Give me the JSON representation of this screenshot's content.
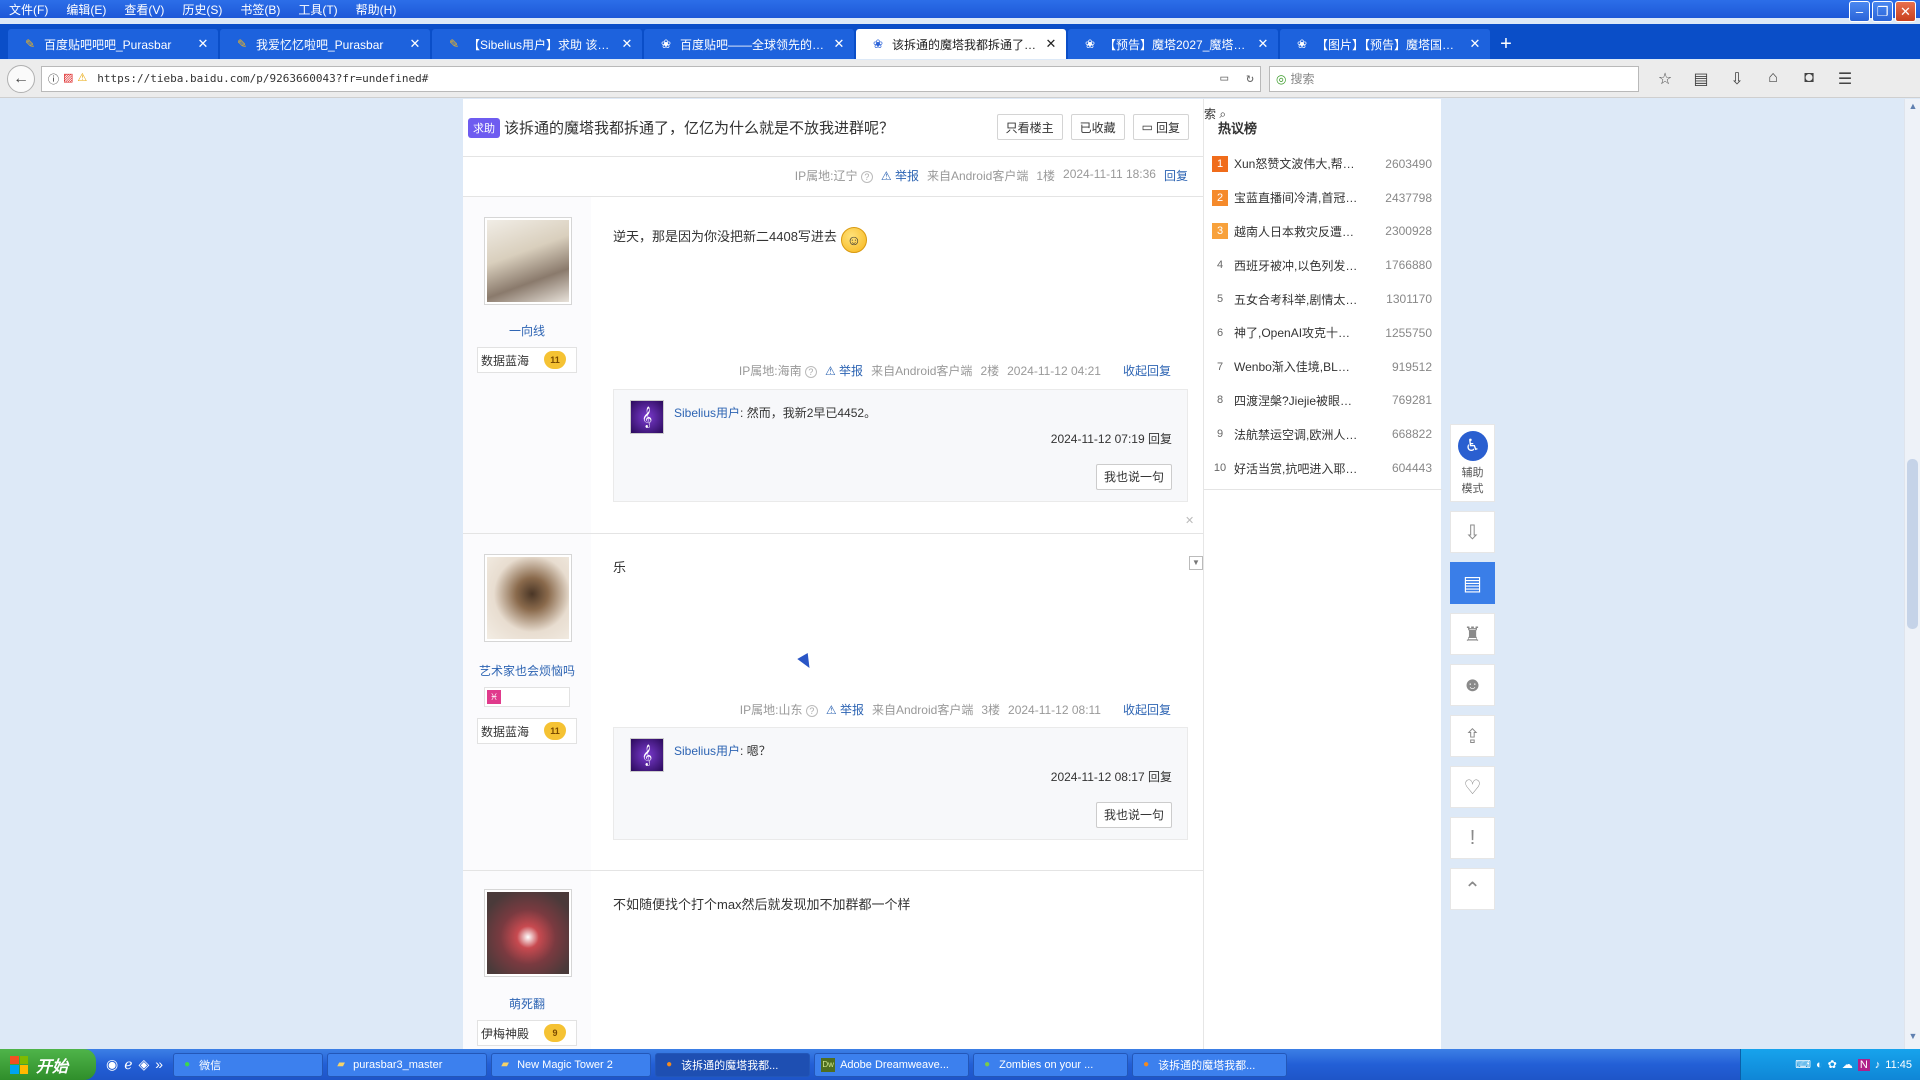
{
  "menubar": {
    "items": [
      "文件(F)",
      "编辑(E)",
      "查看(V)",
      "历史(S)",
      "书签(B)",
      "工具(T)",
      "帮助(H)"
    ]
  },
  "tabs": [
    {
      "title": "百度贴吧吧吧_Purasbar",
      "icon": "pencil-icon"
    },
    {
      "title": "我爱忆忆啦吧_Purasbar",
      "icon": "pencil-icon"
    },
    {
      "title": "【Sibelius用户】求助 该…",
      "icon": "pencil-icon"
    },
    {
      "title": "百度贴吧——全球领先的…",
      "icon": "paw-icon"
    },
    {
      "title": "该拆通的魔塔我都拆通了…",
      "icon": "paw-icon",
      "active": true
    },
    {
      "title": "【预告】魔塔2027_魔塔吧…",
      "icon": "paw-icon"
    },
    {
      "title": "【图片】【预告】魔塔国…",
      "icon": "paw-icon"
    }
  ],
  "nav": {
    "url": "https://tieba.baidu.com/p/9263660043?fr=undefined#",
    "search_placeholder": "搜索"
  },
  "thread": {
    "tag": "求助",
    "title": "该拆通的魔塔我都拆通了，亿亿为什么就是不放我进群呢？",
    "buttons": [
      "只看楼主",
      "已收藏",
      "回复"
    ]
  },
  "floor1_meta": {
    "ip": "IP属地:辽宁",
    "report": "举报",
    "client": "来自Android客户端",
    "floor": "1楼",
    "time": "2024-11-11 18:36",
    "reply": "回复"
  },
  "posts": [
    {
      "author": "一向线",
      "badge_text": "数据蓝海",
      "level": "11",
      "content": "逆天，那是因为你没把新二4408写进去",
      "ip": "IP属地:海南",
      "report": "举报",
      "client": "来自Android客户端",
      "floor": "2楼",
      "time": "2024-11-12 04:21",
      "collapse": "收起回复",
      "lzl": {
        "user": "Sibelius用户",
        "text": ": 然而，我新2早已4452。",
        "time": "2024-11-12 07:19",
        "reply": "回复",
        "btn": "我也说一句"
      }
    },
    {
      "author": "艺术家也会烦恼吗",
      "badge_text": "数据蓝海",
      "level": "11",
      "content": "乐",
      "ip": "IP属地:山东",
      "report": "举报",
      "client": "来自Android客户端",
      "floor": "3楼",
      "time": "2024-11-12 08:11",
      "collapse": "收起回复",
      "lzl": {
        "user": "Sibelius用户",
        "text": ": 嗯？",
        "time": "2024-11-12 08:17",
        "reply": "回复",
        "btn": "我也说一句"
      }
    },
    {
      "author": "萌死翻",
      "badge_text": "伊梅神殿",
      "level": "9",
      "content": "不如随便找个打个max然后就发现加不加群都一个样"
    }
  ],
  "sidebar": {
    "hot_title": "热议榜",
    "hot_list": [
      {
        "rank": "1",
        "text": "Xun怒赞文波伟大,帮…",
        "num": "2603490"
      },
      {
        "rank": "2",
        "text": "宝蓝直播间冷清,首冠…",
        "num": "2437798"
      },
      {
        "rank": "3",
        "text": "越南人日本救灾反遭…",
        "num": "2300928"
      },
      {
        "rank": "4",
        "text": "西班牙被冲,以色列发…",
        "num": "1766880"
      },
      {
        "rank": "5",
        "text": "五女合考科举,剧情太…",
        "num": "1301170"
      },
      {
        "rank": "6",
        "text": "神了,OpenAI攻克十…",
        "num": "1255750"
      },
      {
        "rank": "7",
        "text": "Wenbo渐入佳境,BL…",
        "num": "919512"
      },
      {
        "rank": "8",
        "text": "四渡涅槃?Jiejie被眼…",
        "num": "769281"
      },
      {
        "rank": "9",
        "text": "法航禁运空调,欧洲人…",
        "num": "668822"
      },
      {
        "rank": "10",
        "text": "好活当赏,抗吧进入耶…",
        "num": "604443"
      }
    ]
  },
  "side_toolbar": {
    "assist_label_1": "辅助",
    "assist_label_2": "模式"
  },
  "taskbar": {
    "start": "开始",
    "items": [
      {
        "label": "微信",
        "icon": "wechat-icon"
      },
      {
        "label": "purasbar3_master",
        "icon": "folder-icon"
      },
      {
        "label": "New Magic Tower 2",
        "icon": "folder-icon"
      },
      {
        "label": "该拆通的魔塔我都...",
        "icon": "firefox-icon",
        "active": true
      },
      {
        "label": "Adobe Dreamweave...",
        "icon": "dreamweaver-icon"
      },
      {
        "label": "Zombies on your ...",
        "icon": "zombie-icon"
      },
      {
        "label": "该拆通的魔塔我都...",
        "icon": "firefox-icon"
      }
    ],
    "clock": "11:45"
  },
  "colors": {
    "accent": "#2d64b3",
    "tag_bg": "#6e5cf0",
    "taskbar": "#235fd6"
  }
}
